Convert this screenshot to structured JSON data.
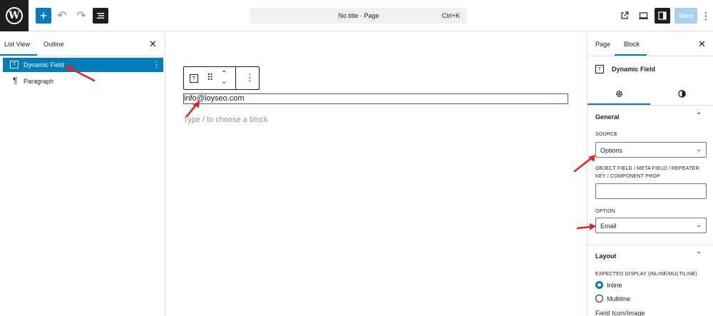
{
  "colors": {
    "accent": "#007cba",
    "arrow": "#e02424",
    "dark": "#1e1e1e"
  },
  "topbar": {
    "logo_glyph": "W",
    "add_icon": "plus-icon",
    "undo_icon": "undo-icon",
    "redo_icon": "redo-icon",
    "document_overview_icon": "list-view-icon",
    "command": {
      "title": "No title · Page",
      "shortcut": "Ctrl+K"
    },
    "view_icon": "external-link-icon",
    "preview_icon": "desktop-icon",
    "settings_icon": "sidebar-toggle-icon",
    "save_label": "Save",
    "more_icon": "more-vertical-icon"
  },
  "left_panel": {
    "tabs": [
      {
        "label": "List View"
      },
      {
        "label": "Outline"
      }
    ],
    "close_glyph": "✕",
    "items": [
      {
        "label": "Dynamic Field",
        "icon": "dynamic-field-icon",
        "selected": true,
        "options_glyph": "⋮"
      },
      {
        "label": "Paragraph",
        "icon": "paragraph-icon",
        "selected": false
      }
    ]
  },
  "canvas": {
    "email_text": "info@loyseo.com",
    "appender_placeholder": "Type / to choose a block"
  },
  "right_panel": {
    "tabs": [
      {
        "label": "Page"
      },
      {
        "label": "Block"
      }
    ],
    "close_glyph": "✕",
    "block_name": "Dynamic Field",
    "settings_icon": "cog-icon",
    "styles_icon": "contrast-icon",
    "general": {
      "title": "General",
      "source_label": "SOURCE",
      "source_value": "Options",
      "object_field_label": "OBJECT FIELD / META FIELD / REPEATER KEY / COMPONENT PROP",
      "object_field_value": "",
      "option_label": "OPTION",
      "option_value": "Email"
    },
    "layout": {
      "title": "Layout",
      "display_label": "EXPECTED DISPLAY (INLINE/MULTILINE)",
      "options": [
        {
          "label": "Inline",
          "checked": true
        },
        {
          "label": "Multiline",
          "checked": false
        }
      ],
      "next_label": "Field Icon/Image"
    }
  }
}
